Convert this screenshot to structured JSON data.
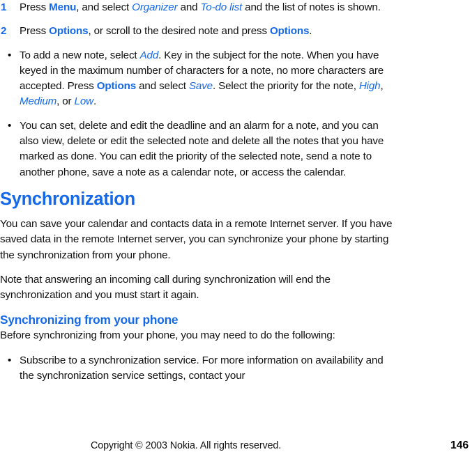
{
  "document": {
    "type": "user-guide-page",
    "accent_color": "#1569E8",
    "text_color": "#111111",
    "background_color": "#ffffff"
  },
  "steps": [
    {
      "number": "1",
      "runs": [
        {
          "text": "Press ",
          "style": "plain"
        },
        {
          "text": "Menu",
          "style": "ui"
        },
        {
          "text": ", and select ",
          "style": "plain"
        },
        {
          "text": "Organizer",
          "style": "menu"
        },
        {
          "text": " and ",
          "style": "plain"
        },
        {
          "text": "To-do list",
          "style": "menu"
        },
        {
          "text": " and the list of notes is shown.",
          "style": "plain"
        }
      ]
    },
    {
      "number": "2",
      "runs": [
        {
          "text": "Press ",
          "style": "plain"
        },
        {
          "text": "Options",
          "style": "ui"
        },
        {
          "text": ", or scroll to the desired note and press ",
          "style": "plain"
        },
        {
          "text": "Options",
          "style": "ui"
        },
        {
          "text": ".",
          "style": "plain"
        }
      ]
    }
  ],
  "bullets_first": [
    {
      "marker": "•",
      "runs": [
        {
          "text": "To add a new note, select ",
          "style": "plain"
        },
        {
          "text": "Add",
          "style": "menu"
        },
        {
          "text": ". Key in the subject for the note. When you have keyed in the maximum number of characters for a note, no more characters are accepted. Press ",
          "style": "plain"
        },
        {
          "text": "Options",
          "style": "ui"
        },
        {
          "text": " and select ",
          "style": "plain"
        },
        {
          "text": "Save",
          "style": "menu"
        },
        {
          "text": ". Select the priority for the note, ",
          "style": "plain"
        },
        {
          "text": "High",
          "style": "menu"
        },
        {
          "text": ", ",
          "style": "plain"
        },
        {
          "text": "Medium",
          "style": "menu"
        },
        {
          "text": ", or ",
          "style": "plain"
        },
        {
          "text": "Low",
          "style": "menu"
        },
        {
          "text": ".",
          "style": "plain"
        }
      ]
    },
    {
      "marker": "•",
      "runs": [
        {
          "text": "You can set, delete and edit the deadline and an alarm for a note, and you can also view, delete or edit the selected note and delete all the notes that you have marked as done. You can edit the priority of the selected note, send a note to another phone, save a note as a calendar note, or access the calendar.",
          "style": "plain"
        }
      ]
    }
  ],
  "section": {
    "heading": "Synchronization",
    "paragraphs": [
      "You can save your calendar and contacts data in a remote Internet server. If you have saved data in the remote Internet server, you can synchronize your phone by starting the synchronization from your phone.",
      "Note that answering an incoming call during synchronization will end the synchronization and you must start it again."
    ],
    "subheading": "Synchronizing from your phone",
    "intro": "Before synchronizing from your phone, you may need to do the following:",
    "bullets": [
      {
        "marker": "•",
        "runs": [
          {
            "text": "Subscribe to a synchronization service. For more information on availability and the synchronization service settings, contact your",
            "style": "plain"
          }
        ]
      }
    ]
  },
  "footer": {
    "copyright": "Copyright © 2003 Nokia. All rights reserved.",
    "page_number": "146"
  }
}
